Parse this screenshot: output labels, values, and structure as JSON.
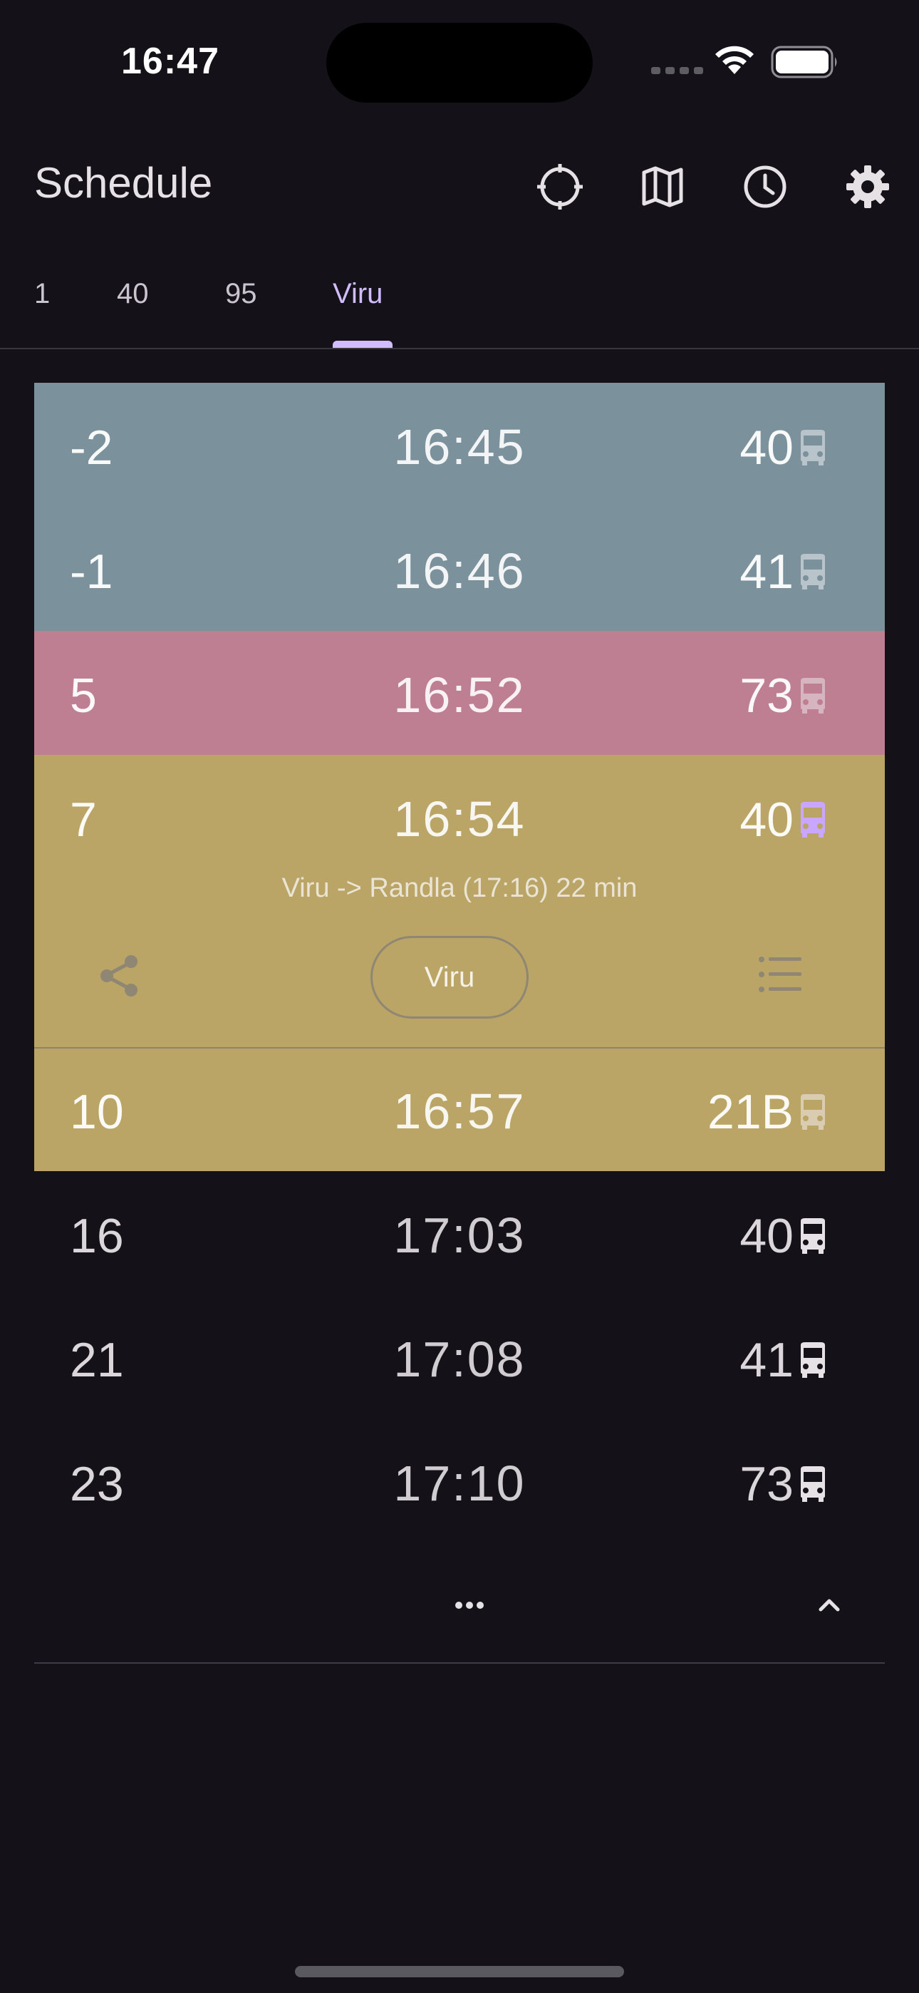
{
  "status_bar": {
    "time": "16:47"
  },
  "app_bar": {
    "title": "Schedule",
    "actions": [
      "locate-icon",
      "map-icon",
      "clock-icon",
      "settings-icon"
    ]
  },
  "tabs": [
    {
      "label": "1"
    },
    {
      "label": "40"
    },
    {
      "label": "95"
    },
    {
      "label": "Viru",
      "active": true
    }
  ],
  "colors": {
    "past": "#7b919c",
    "soon": "#be7f93",
    "near": "#baa566",
    "accent": "#d0bcff",
    "background": "#141218"
  },
  "departures": [
    {
      "minutes": "-2",
      "time": "16:45",
      "line": "40",
      "state": "past"
    },
    {
      "minutes": "-1",
      "time": "16:46",
      "line": "41",
      "state": "past"
    },
    {
      "minutes": "5",
      "time": "16:52",
      "line": "73",
      "state": "soon"
    },
    {
      "minutes": "7",
      "time": "16:54",
      "line": "40",
      "state": "near",
      "expanded": true
    },
    {
      "minutes": "10",
      "time": "16:57",
      "line": "21B",
      "state": "near"
    },
    {
      "minutes": "16",
      "time": "17:03",
      "line": "40",
      "state": "future"
    },
    {
      "minutes": "21",
      "time": "17:08",
      "line": "41",
      "state": "future"
    },
    {
      "minutes": "23",
      "time": "17:10",
      "line": "73",
      "state": "future"
    }
  ],
  "expanded_details": {
    "route_text": "Viru -> Randla (17:16) 22 min",
    "stop_button": "Viru"
  }
}
